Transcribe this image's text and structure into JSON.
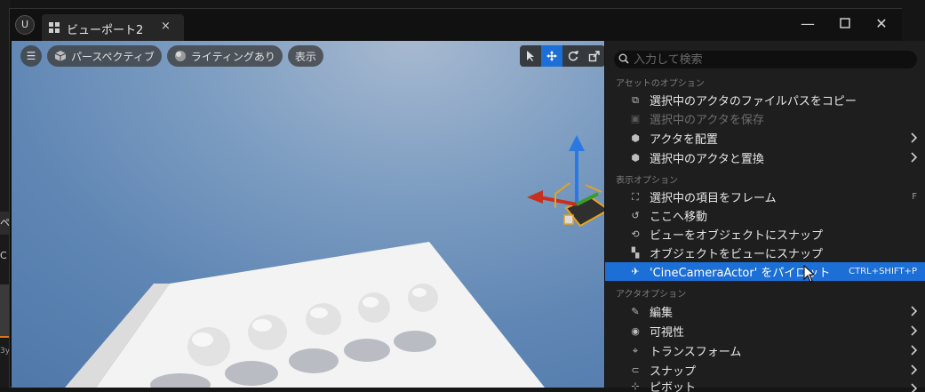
{
  "left_panel": {
    "label_pe": "ペ",
    "label_c": "C",
    "label_by": "3y"
  },
  "window": {
    "tab_label": "ビューポート2",
    "tab_close": "×",
    "logo": "U",
    "min_glyph": "—",
    "max_glyph": "☐",
    "close_glyph": "✕"
  },
  "viewport": {
    "menu_button_glyph": "☰",
    "perspective_label": "パースペクティブ",
    "lighting_label": "ライティングあり",
    "show_label": "表示",
    "tools": [
      "select",
      "translate",
      "rotate",
      "scale"
    ]
  },
  "context_menu": {
    "search_placeholder": "入力して検索",
    "sections": {
      "asset_options": "アセットのオプション",
      "display_options": "表示オプション",
      "actor_options": "アクタオプション"
    },
    "items": {
      "copy_path": "選択中のアクタのファイルパスをコピー",
      "save_actor": "選択中のアクタを保存",
      "place_actor": "アクタを配置",
      "replace_actor": "選択中のアクタと置換",
      "frame_selected": "選択中の項目をフレーム",
      "frame_shortcut": "F",
      "move_here": "ここへ移動",
      "snap_view_to_object": "ビューをオブジェクトにスナップ",
      "snap_object_to_view": "オブジェクトをビューにスナップ",
      "pilot": "'CineCameraActor' をパイロット",
      "pilot_shortcut": "CTRL+SHIFT+P",
      "edit": "編集",
      "visibility": "可視性",
      "transform": "トランスフォーム",
      "snap": "スナップ",
      "pivot_partial": "ピボット"
    }
  },
  "colors": {
    "accent": "#1c6fd6",
    "menu_bg": "#1e1e1e",
    "sky_top": "#a7b9d0",
    "sky_bottom": "#4b74a6"
  }
}
